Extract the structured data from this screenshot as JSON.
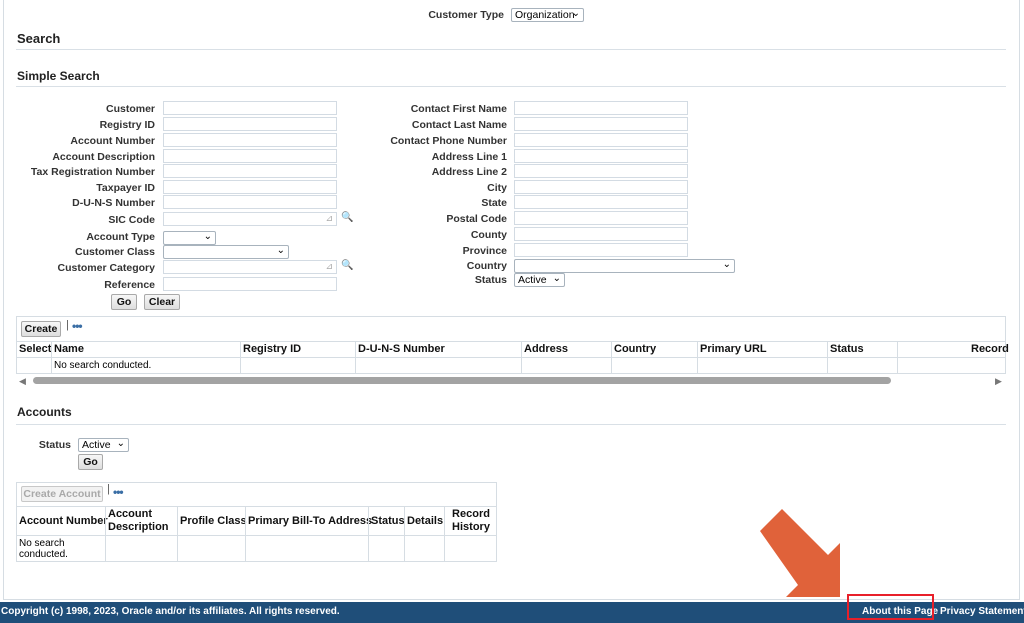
{
  "customer_type": {
    "label": "Customer Type",
    "value": "Organization"
  },
  "search_header": "Search",
  "simple_search": {
    "header": "Simple Search",
    "left_fields": [
      {
        "label": "Customer"
      },
      {
        "label": "Registry ID"
      },
      {
        "label": "Account Number"
      },
      {
        "label": "Account Description"
      },
      {
        "label": "Tax Registration Number"
      },
      {
        "label": "Taxpayer ID"
      },
      {
        "label": "D-U-N-S Number"
      },
      {
        "label": "SIC Code"
      },
      {
        "label": "Account Type"
      },
      {
        "label": "Customer Class"
      },
      {
        "label": "Customer Category"
      },
      {
        "label": "Reference"
      }
    ],
    "right_fields": [
      {
        "label": "Contact First Name"
      },
      {
        "label": "Contact Last Name"
      },
      {
        "label": "Contact Phone Number"
      },
      {
        "label": "Address Line 1"
      },
      {
        "label": "Address Line 2"
      },
      {
        "label": "City"
      },
      {
        "label": "State"
      },
      {
        "label": "Postal Code"
      },
      {
        "label": "County"
      },
      {
        "label": "Province"
      },
      {
        "label": "Country"
      },
      {
        "label": "Status",
        "value": "Active"
      }
    ],
    "go_label": "Go",
    "clear_label": "Clear"
  },
  "results": {
    "create_label": "Create",
    "columns": [
      "Select",
      "Name",
      "Registry ID",
      "D-U-N-S Number",
      "Address",
      "Country",
      "Primary URL",
      "Status",
      "Record"
    ],
    "empty_text": "No search conducted."
  },
  "accounts": {
    "header": "Accounts",
    "status_label": "Status",
    "status_value": "Active",
    "go_label": "Go",
    "create_account_label": "Create Account",
    "columns": [
      "Account Number",
      "Account Description",
      "Profile Class",
      "Primary Bill-To Address",
      "Status",
      "Details",
      "Record History"
    ],
    "empty_text": "No search conducted."
  },
  "footer": {
    "copyright": "Copyright (c) 1998, 2023, Oracle and/or its affiliates. All rights reserved.",
    "about_link": "About this Page",
    "privacy_link": "Privacy Statement"
  },
  "colors": {
    "footer_bg": "#1f4e79",
    "annotation_arrow": "#e0623a",
    "annotation_box": "#e8202a"
  }
}
